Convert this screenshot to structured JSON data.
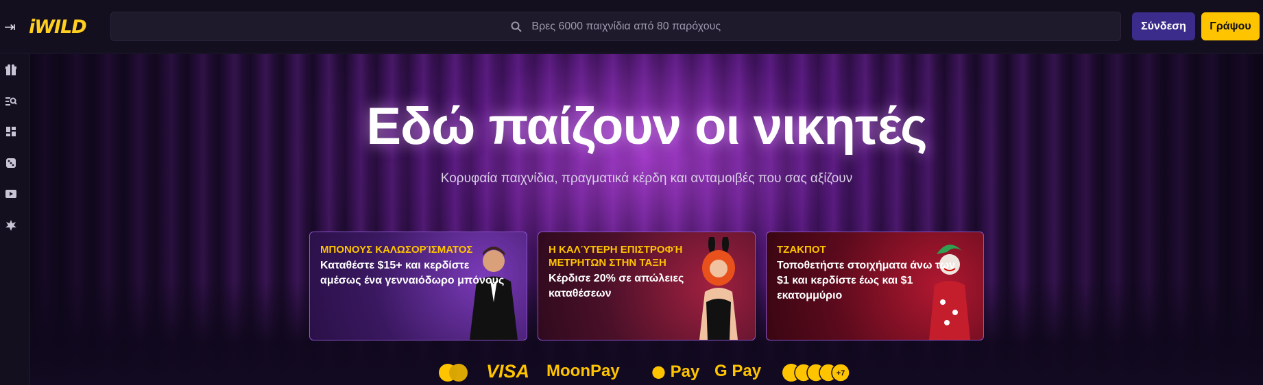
{
  "header": {
    "collapse_icon": "sidebar-expand-icon",
    "logo_text": "iWILD",
    "search_placeholder": "Βρες 6000 παιχνίδια από 80 παρόχους",
    "login_label": "Σύνδεση",
    "register_label": "Γράψου"
  },
  "sidebar": {
    "items": [
      {
        "icon": "gift-icon"
      },
      {
        "icon": "search-list-icon"
      },
      {
        "icon": "dashboard-icon"
      },
      {
        "icon": "dice-icon"
      },
      {
        "icon": "play-icon"
      },
      {
        "icon": "burst-icon"
      }
    ]
  },
  "hero": {
    "title": "Εδώ παίζουν οι νικητές",
    "subtitle": "Κορυφαία παιχνίδια, πραγματικά κέρδη και ανταμοιβές που σας αξίζουν"
  },
  "promos": [
    {
      "label": "ΜΠΟΝΟΥΣ ΚΑΛΩΣΟΡΊΣΜΑΤΟΣ",
      "text": "Καταθέστε $15+ και κερδίστε αμέσως ένα γενναιόδωρο μπόνους"
    },
    {
      "label": "Η ΚΑΛΎΤΕΡΗ ΕΠΙΣΤΡΟΦΉ ΜΕΤΡΗΤΩΝ ΣΤΗΝ ΤΑΞΗ",
      "text": "Κέρδισε 20% σε απώλειες καταθέσεων"
    },
    {
      "label": "ΤΖΑΚΠΟΤ",
      "text": "Τοποθετήστε στοιχήματα άνω των $1 και κερδίστε έως και $1 εκατομμύριο"
    }
  ],
  "payments": {
    "visa": "VISA",
    "moonpay": "MoonPay",
    "applepay": "Pay",
    "googlepay": "Pay",
    "crypto_more": "+7"
  },
  "colors": {
    "accent_yellow": "#ffc400",
    "login_purple": "#3b2b8a",
    "background": "#0f0b1a"
  }
}
